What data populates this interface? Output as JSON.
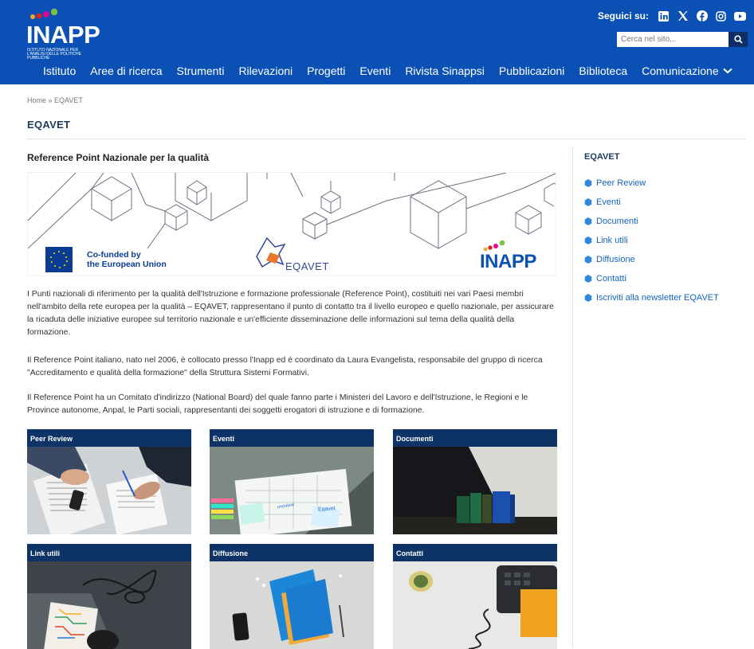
{
  "header": {
    "logo_text": "INAPP",
    "logo_subtitle": "Istituto Nazionale per l'Analisi delle Politiche Pubbliche",
    "follow_label": "Seguici su:",
    "social_icons": [
      "linkedin-icon",
      "x-icon",
      "facebook-icon",
      "instagram-icon",
      "youtube-icon"
    ],
    "search_placeholder": "Cerca nel sito...",
    "nav": [
      "Istituto",
      "Aree di ricerca",
      "Strumenti",
      "Rilevazioni",
      "Progetti",
      "Eventi",
      "Rivista Sinappsi",
      "Pubblicazioni",
      "Biblioteca",
      "Comunicazione"
    ]
  },
  "breadcrumb": "Home » EQAVET",
  "page_title": "EQAVET",
  "main": {
    "section_title": "Reference Point Nazionale per la qualità",
    "banner": {
      "eu_text_1": "Co-funded by",
      "eu_text_2": "the European Union",
      "eqavet_logo": "EQAVET",
      "inapp_logo": "INAPP"
    },
    "paragraphs": [
      "I Punti nazionali di riferimento per la qualità dell'Istruzione e formazione professionale (Reference Point), costituiti nei vari Paesi membri nell'ambito della rete europea per la qualità – EQAVET, rappresentano il punto di contatto tra il livello europeo e quello nazionale, per assicurare la ricaduta delle iniziative europee sul territorio nazionale e un'efficiente disseminazione delle informazioni sul tema della qualità della formazione.",
      "Il Reference Point italiano, nato nel 2006, è collocato presso l'Inapp ed è coordinato da Laura Evangelista, responsabile del gruppo di ricerca \"Accreditamento e qualità della formazione\" della Struttura Sistemi Formativi.",
      "Il Reference Point ha un Comitato d'indirizzo (National Board) del quale fanno parte i Ministeri del Lavoro e dell'Istruzione, le Regioni e le Province autonome, Anpal, le Parti sociali, rappresentanti dei soggetti erogatori di istruzione e di formazione."
    ],
    "cards": [
      "Peer Review",
      "Eventi",
      "Documenti",
      "Link utili",
      "Diffusione",
      "Contatti"
    ],
    "card_photo_notes": [
      "rrreview",
      "Eqavet"
    ]
  },
  "sidebar": {
    "title": "EQAVET",
    "items": [
      "Peer Review",
      "Eventi",
      "Documenti",
      "Link utili",
      "Diffusione",
      "Contatti",
      "Iscriviti alla newsletter EQAVET"
    ]
  },
  "colors": {
    "header_blue": "#0b51b5",
    "card_bar": "#0e3366",
    "link_blue": "#1565c0"
  }
}
